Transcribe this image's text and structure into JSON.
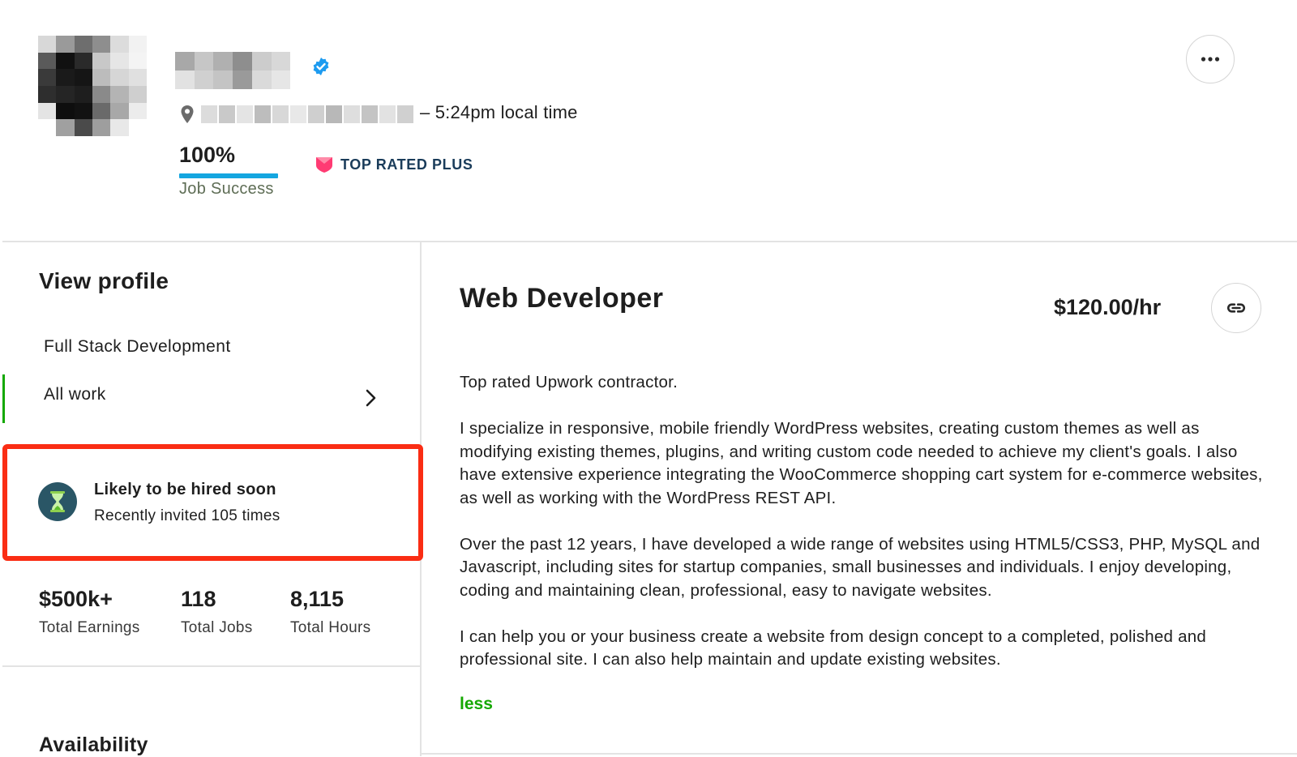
{
  "header": {
    "local_time": "– 5:24pm local time",
    "job_success": {
      "value": "100%",
      "label": "Job Success",
      "fraction": 1.0
    },
    "badge": {
      "label": "TOP RATED PLUS",
      "color": "#ff3b73"
    },
    "verified_icon": "verified-badge-icon",
    "more_icon": "ellipsis-icon"
  },
  "sidebar": {
    "title": "View profile",
    "nav": [
      {
        "label": "Full Stack Development",
        "active": false
      },
      {
        "label": "All work",
        "active": true
      }
    ],
    "highlight": {
      "title": "Likely to be hired soon",
      "subtitle": "Recently invited 105 times",
      "icon": "hourglass-icon"
    },
    "stats": [
      {
        "value": "$500k+",
        "label": "Total Earnings"
      },
      {
        "value": "118",
        "label": "Total Jobs"
      },
      {
        "value": "8,115",
        "label": "Total Hours"
      }
    ],
    "availability_title": "Availability"
  },
  "main": {
    "title": "Web Developer",
    "rate": "$120.00/hr",
    "link_icon": "link-icon",
    "description": [
      "Top rated Upwork contractor.",
      "I specialize in responsive, mobile friendly WordPress websites, creating custom themes as well as modifying existing themes, plugins, and writing custom code needed to achieve my client's goals. I also have extensive experience integrating the WooCommerce shopping cart system for e-commerce websites, as well as working with the WordPress REST API.",
      "Over the past 12 years, I have developed a wide range of websites using HTML5/CSS3, PHP, MySQL and Javascript, including sites for startup companies, small businesses and individuals. I enjoy developing, coding and maintaining clean, professional, easy to navigate websites.",
      "I can help you or your business create a website from design concept to a completed, polished and professional site. I can also help maintain and update existing websites."
    ],
    "less_label": "less"
  },
  "colors": {
    "accent_green": "#14a800",
    "highlight_border": "#fa2d14",
    "progress_blue": "#14a6e0"
  }
}
